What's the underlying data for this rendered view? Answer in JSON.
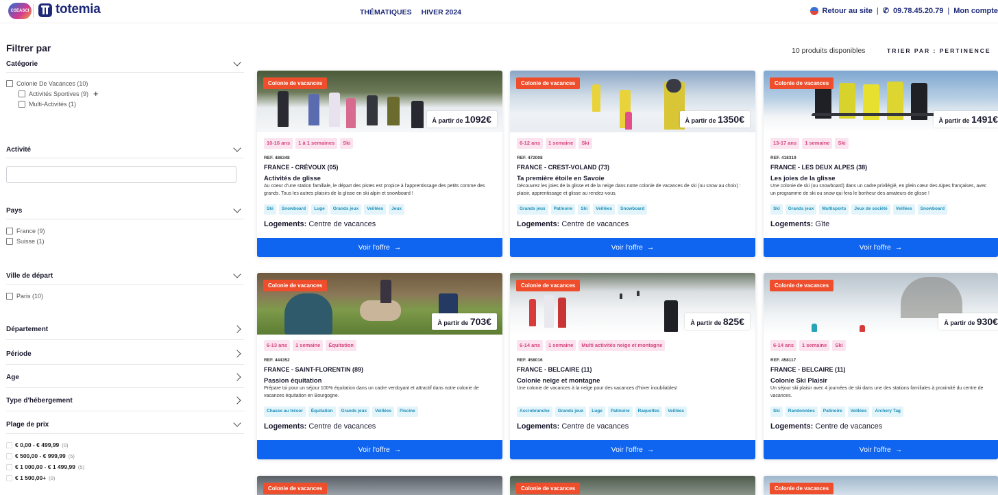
{
  "header": {
    "partner_logo": "CSEASCI",
    "brand": "totemia",
    "nav": [
      "THÉMATIQUES",
      "HIVER 2024"
    ],
    "back_to_site": "Retour au site",
    "phone": "09.78.45.20.79",
    "account": "Mon compte",
    "separator": "|"
  },
  "sidebar": {
    "title": "Filtrer par",
    "categorie": {
      "label": "Catégorie",
      "items": [
        {
          "label": "Colonie De Vacances (10)"
        },
        {
          "label": "Activités Sportives (9)"
        },
        {
          "label": "Multi-Activités (1)"
        }
      ]
    },
    "activite": {
      "label": "Activité",
      "value": "",
      "placeholder": ""
    },
    "pays": {
      "label": "Pays",
      "items": [
        {
          "label": "France (9)"
        },
        {
          "label": "Suisse (1)"
        }
      ]
    },
    "ville": {
      "label": "Ville de départ",
      "items": [
        {
          "label": "Paris (10)"
        }
      ]
    },
    "departement": "Département",
    "periode": "Période",
    "age": "Age",
    "hebergement": "Type d'hébergement",
    "prix": {
      "label": "Plage de prix",
      "items": [
        {
          "range": "€ 0,00 - € 499,99",
          "count": "(0)"
        },
        {
          "range": "€ 500,00 - € 999,99",
          "count": "(5)"
        },
        {
          "range": "€ 1 000,00 - € 1 499,99",
          "count": "(5)"
        },
        {
          "range": "€ 1 500,00+",
          "count": "(0)"
        }
      ]
    }
  },
  "results": {
    "count": "10 produits disponibles",
    "sort": "TRIER PAR : PERTINENCE"
  },
  "cards": [
    {
      "badge": "Colonie de vacances",
      "price_prefix": "À partir de",
      "price": "1092€",
      "tags": [
        "10-16 ans",
        "1 à 1 semaines",
        "Ski"
      ],
      "ref": "REF. 486348",
      "place": "FRANCE - CRÉVOUX (05)",
      "title": "Activités de glisse",
      "desc": "Au coeur d'une station familiale, le départ des pistes est propice à l'apprentissage des petits comme des grands. Tous les autres plaisirs de la glisse en ski alpin et snowboard !",
      "activities": [
        "Ski",
        "Snowboard",
        "Luge",
        "Grands jeux",
        "Veillées",
        "Jeux"
      ],
      "logement_label": "Logements:",
      "logement": "Centre de vacances",
      "cta": "Voir l'offre"
    },
    {
      "badge": "Colonie de vacances",
      "price_prefix": "À partir de",
      "price": "1350€",
      "tags": [
        "6-12 ans",
        "1 semaine",
        "Ski"
      ],
      "ref": "REF. 472008",
      "place": "FRANCE - CREST-VOLAND (73)",
      "title": "Ta première étoile en Savoie",
      "desc": "Découvrez les joies de la glisse et de la neige dans notre colonie de vacances de ski (ou snow au choix) : plaisir, apprentissage et glisse au rendez-vous.",
      "activities": [
        "Grands jeux",
        "Patinoire",
        "Ski",
        "Veillées",
        "Snowboard"
      ],
      "logement_label": "Logements:",
      "logement": "Centre de vacances",
      "cta": "Voir l'offre"
    },
    {
      "badge": "Colonie de vacances",
      "price_prefix": "À partir de",
      "price": "1491€",
      "tags": [
        "13-17 ans",
        "1 semaine",
        "Ski"
      ],
      "ref": "REF. 418319",
      "place": "FRANCE - LES DEUX ALPES (38)",
      "title": "Les joies de la glisse",
      "desc": "Une colonie de ski (ou snowboard) dans un cadre privilégié, en plein cœur des Alpes françaises, avec un programme de ski ou snow qui fera le bonheur des amateurs de glisse !",
      "activities": [
        "Ski",
        "Grands jeux",
        "Multisports",
        "Jeux de société",
        "Veillées",
        "Snowboard"
      ],
      "logement_label": "Logements:",
      "logement": "Gîte",
      "cta": "Voir l'offre"
    },
    {
      "badge": "Colonie de vacances",
      "price_prefix": "À partir de",
      "price": "703€",
      "tags": [
        "6-13 ans",
        "1 semaine",
        "Équitation"
      ],
      "ref": "REF. 444352",
      "place": "FRANCE - SAINT-FLORENTIN (89)",
      "title": "Passion équitation",
      "desc": "Prépare toi pour un séjour 100% équitation dans un cadre verdoyant et attractif dans notre colonie de vacances équitation en Bourgogne.",
      "activities": [
        "Chasse au trésor",
        "Équitation",
        "Grands jeux",
        "Veillées",
        "Piscine"
      ],
      "logement_label": "Logements:",
      "logement": "Centre de vacances",
      "cta": "Voir l'offre"
    },
    {
      "badge": "Colonie de vacances",
      "price_prefix": "À partir de",
      "price": "825€",
      "tags": [
        "6-14 ans",
        "1 semaine",
        "Multi activités neige et montagne"
      ],
      "ref": "REF. 458016",
      "place": "FRANCE - BELCAIRE (11)",
      "title": "Colonie neige et montagne",
      "desc": "Une colonie de vacances à la neige pour des vacances d'hiver inoubliables!",
      "activities": [
        "Accrobranche",
        "Grands jeux",
        "Luge",
        "Patinoire",
        "Raquettes",
        "Veillées"
      ],
      "logement_label": "Logements:",
      "logement": "Centre de vacances",
      "cta": "Voir l'offre"
    },
    {
      "badge": "Colonie de vacances",
      "price_prefix": "À partir de",
      "price": "930€",
      "tags": [
        "6-14 ans",
        "1 semaine",
        "Ski"
      ],
      "ref": "REF. 458117",
      "place": "FRANCE - BELCAIRE (11)",
      "title": "Colonie Ski Plaisir",
      "desc": "Un séjour ski plaisir avec 4 journées de ski dans une des stations familiales à proximité du centre de vacances.",
      "activities": [
        "Ski",
        "Randonnées",
        "Patinoire",
        "Veillées",
        "Archery Tag"
      ],
      "logement_label": "Logements:",
      "logement": "Centre de vacances",
      "cta": "Voir l'offre"
    },
    {
      "badge": "Colonie de vacances"
    },
    {
      "badge": "Colonie de vacances"
    },
    {
      "badge": "Colonie de vacances"
    }
  ],
  "colors": {
    "accent": "#0f64f0",
    "badge": "#ef4e2c",
    "tag_bg": "#fbe4ef",
    "activity_bg": "#e3f4fa"
  }
}
